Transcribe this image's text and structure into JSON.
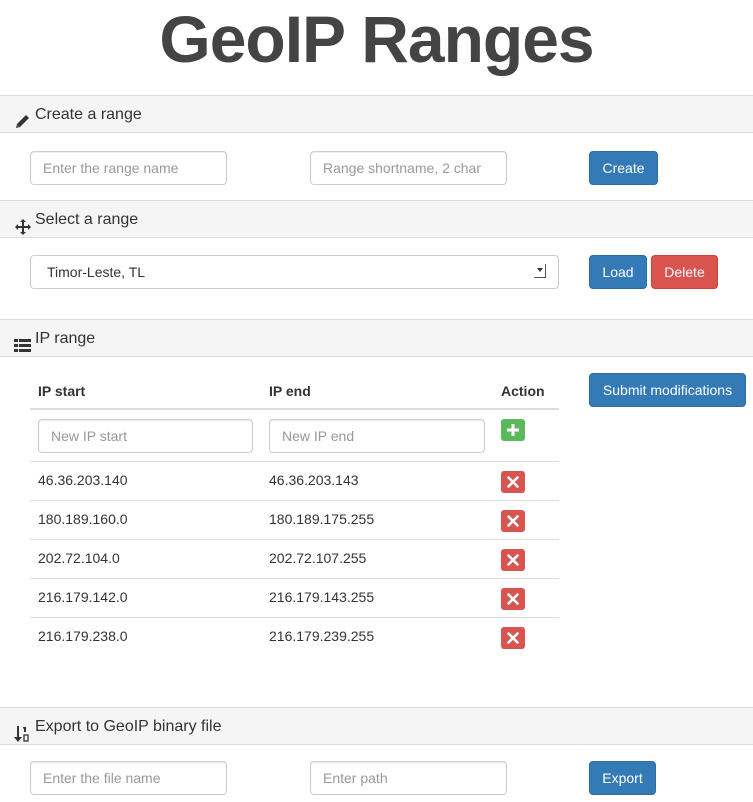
{
  "page_title": "GeoIP Ranges",
  "create": {
    "heading": "Create a range",
    "icon": "pencil-icon",
    "name_placeholder": "Enter the range name",
    "short_placeholder": "Range shortname, 2 char",
    "create_label": "Create"
  },
  "select": {
    "heading": "Select a range",
    "icon": "move-arrows-icon",
    "selected_value": "Timor-Leste, TL",
    "load_label": "Load",
    "delete_label": "Delete"
  },
  "iprange": {
    "heading": "IP range",
    "icon": "list-icon",
    "col_start": "IP start",
    "col_end": "IP end",
    "col_action": "Action",
    "new_start_placeholder": "New IP start",
    "new_end_placeholder": "New IP end",
    "submit_label": "Submit modifications",
    "rows": [
      {
        "start": "46.36.203.140",
        "end": "46.36.203.143"
      },
      {
        "start": "180.189.160.0",
        "end": "180.189.175.255"
      },
      {
        "start": "202.72.104.0",
        "end": "202.72.107.255"
      },
      {
        "start": "216.179.142.0",
        "end": "216.179.143.255"
      },
      {
        "start": "216.179.238.0",
        "end": "216.179.239.255"
      }
    ]
  },
  "export": {
    "heading": "Export to GeoIP binary file",
    "icon": "sort-export-icon",
    "file_placeholder": "Enter the file name",
    "path_placeholder": "Enter path",
    "export_label": "Export"
  },
  "colors": {
    "primary": "#337ab7",
    "danger": "#d9534f",
    "success": "#5cb85c",
    "panel_bg": "#f5f5f5"
  }
}
